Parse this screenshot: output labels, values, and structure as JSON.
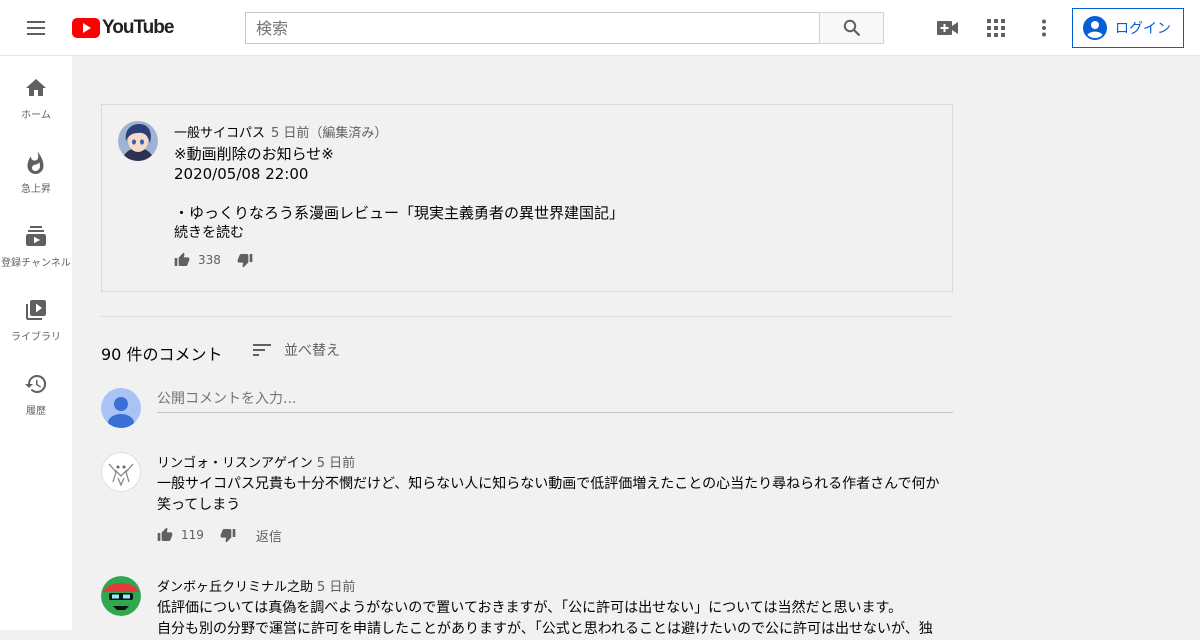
{
  "header": {
    "logo_text": "YouTube",
    "search_placeholder": "検索",
    "login_label": "ログイン"
  },
  "sidebar": {
    "items": [
      {
        "label": "ホーム",
        "icon": "home-icon"
      },
      {
        "label": "急上昇",
        "icon": "flame-icon"
      },
      {
        "label": "登録チャンネル",
        "icon": "subscriptions-icon"
      },
      {
        "label": "ライブラリ",
        "icon": "library-icon"
      },
      {
        "label": "履歴",
        "icon": "history-icon"
      }
    ]
  },
  "post": {
    "author": "一般サイコパス",
    "time": "5 日前（編集済み）",
    "body": "※動画削除のお知らせ※\n2020/05/08 22:00\n\n・ゆっくりなろう系漫画レビュー「現実主義勇者の異世界建国記」",
    "read_more": "続きを読む",
    "likes": "338"
  },
  "comments_header": {
    "count_label": "90 件のコメント",
    "sort_label": "並べ替え"
  },
  "comment_box": {
    "placeholder": "公開コメントを入力..."
  },
  "comments": [
    {
      "author": "リンゴォ・リスンアゲイン",
      "time": "5 日前",
      "text": "一般サイコパス兄貴も十分不憫だけど、知らない人に知らない動画で低評価増えたことの心当たり尋ねられる作者さんで何か\n笑ってしまう",
      "likes": "119",
      "reply_label": "返信"
    },
    {
      "author": "ダンボヶ丘クリミナル之助",
      "time": "5 日前",
      "text": "低評価については真偽を調べようがないので置いておきますが、「公に許可は出せない」については当然だと思います。\n自分も別の分野で運営に許可を申請したことがありますが、「公式と思われることは避けたいので公に許可は出せないが、独",
      "likes": "",
      "reply_label": ""
    }
  ],
  "colors": {
    "brand_red": "#ff0000",
    "link_blue": "#065fd4",
    "background": "#f1f1f1"
  }
}
